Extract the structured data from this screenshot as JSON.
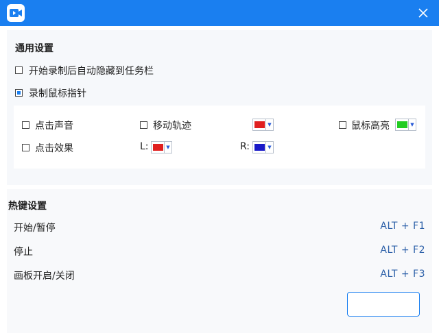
{
  "window": {
    "app_icon": "video-camera-icon",
    "close_icon": "close-icon"
  },
  "general": {
    "title": "通用设置",
    "auto_hide": {
      "label": "开始录制后自动隐藏到任务栏",
      "checked": false
    },
    "record_cursor": {
      "label": "录制鼠标指针",
      "checked": true
    },
    "click_sound": {
      "label": "点击声音",
      "checked": false
    },
    "move_trail": {
      "label": "移动轨迹",
      "checked": false,
      "color": "#e02020"
    },
    "cursor_highlight": {
      "label": "鼠标高亮",
      "checked": false,
      "color": "#22cc22"
    },
    "click_effect": {
      "label": "点击效果",
      "checked": false
    },
    "left_label": "L:",
    "left_color": "#e02020",
    "right_label": "R:",
    "right_color": "#1a1ac8"
  },
  "hotkeys": {
    "title": "热键设置",
    "items": [
      {
        "label": "开始/暂停",
        "value": "ALT + F1"
      },
      {
        "label": "停止",
        "value": "ALT + F2"
      },
      {
        "label": "画板开启/关闭",
        "value": "ALT + F3"
      }
    ]
  }
}
